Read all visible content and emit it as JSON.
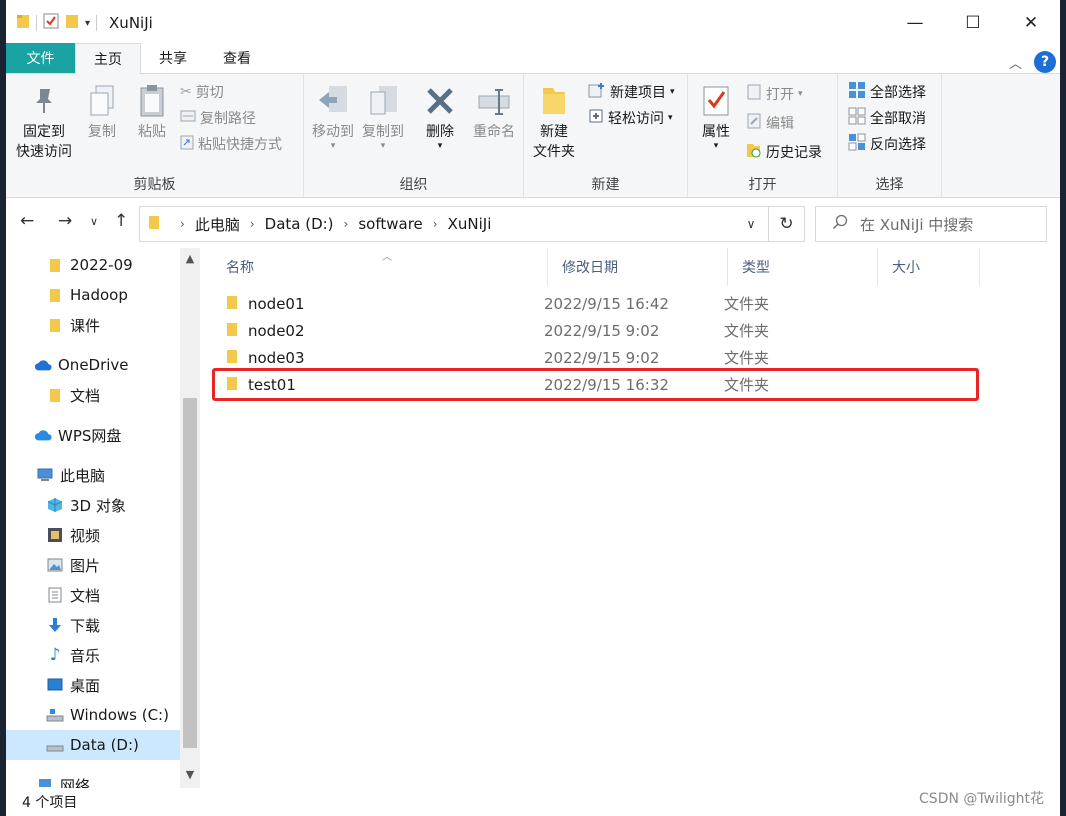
{
  "window": {
    "title": "XuNiJi"
  },
  "tabs": [
    {
      "label": "文件"
    },
    {
      "label": "主页"
    },
    {
      "label": "共享"
    },
    {
      "label": "查看"
    }
  ],
  "help_label": "?",
  "ribbon": {
    "clipboard": {
      "label": "剪贴板",
      "pin": "固定到\n快速访问",
      "pin_l1": "固定到",
      "pin_l2": "快速访问",
      "copy": "复制",
      "paste": "粘贴",
      "cut": "剪切",
      "copy_path": "复制路径",
      "paste_shortcut": "粘贴快捷方式"
    },
    "organize": {
      "label": "组织",
      "move_to": "移动到",
      "copy_to": "复制到",
      "delete": "删除",
      "rename": "重命名"
    },
    "new": {
      "label": "新建",
      "new_folder_l1": "新建",
      "new_folder_l2": "文件夹",
      "new_item": "新建项目",
      "easy_access": "轻松访问"
    },
    "open": {
      "label": "打开",
      "properties": "属性",
      "open": "打开",
      "edit": "编辑",
      "history": "历史记录"
    },
    "select": {
      "label": "选择",
      "select_all": "全部选择",
      "select_none": "全部取消",
      "invert": "反向选择"
    }
  },
  "address": {
    "crumbs": [
      "此电脑",
      "Data (D:)",
      "software",
      "XuNiJi"
    ],
    "search_placeholder": "在 XuNiJi 中搜索"
  },
  "nav": [
    {
      "label": "2022-09",
      "icon": "folder-icon"
    },
    {
      "label": "Hadoop",
      "icon": "folder-icon"
    },
    {
      "label": "课件",
      "icon": "folder-icon"
    },
    {
      "label": "OneDrive",
      "icon": "cloud-icon"
    },
    {
      "label": "文档",
      "icon": "folder-icon"
    },
    {
      "label": "WPS网盘",
      "icon": "cloud-icon"
    },
    {
      "label": "此电脑",
      "icon": "pc-icon"
    },
    {
      "label": "3D 对象",
      "icon": "cube-icon"
    },
    {
      "label": "视频",
      "icon": "video-icon"
    },
    {
      "label": "图片",
      "icon": "picture-icon"
    },
    {
      "label": "文档",
      "icon": "document-icon"
    },
    {
      "label": "下载",
      "icon": "download-icon"
    },
    {
      "label": "音乐",
      "icon": "music-icon"
    },
    {
      "label": "桌面",
      "icon": "desktop-icon"
    },
    {
      "label": "Windows (C:)",
      "icon": "drive-icon"
    },
    {
      "label": "Data (D:)",
      "icon": "drive-icon"
    },
    {
      "label": "网络",
      "icon": "network-icon"
    }
  ],
  "columns": [
    "名称",
    "修改日期",
    "类型",
    "大小"
  ],
  "files": [
    {
      "name": "node01",
      "date": "2022/9/15 16:42",
      "type": "文件夹"
    },
    {
      "name": "node02",
      "date": "2022/9/15 9:02",
      "type": "文件夹"
    },
    {
      "name": "node03",
      "date": "2022/9/15 9:02",
      "type": "文件夹"
    },
    {
      "name": "test01",
      "date": "2022/9/15 16:32",
      "type": "文件夹"
    }
  ],
  "status": "4 个项目",
  "watermark": "CSDN @Twilight花",
  "colors": {
    "accent": "#19a3a2",
    "highlight": "#e82424",
    "selection": "#cce8ff"
  }
}
